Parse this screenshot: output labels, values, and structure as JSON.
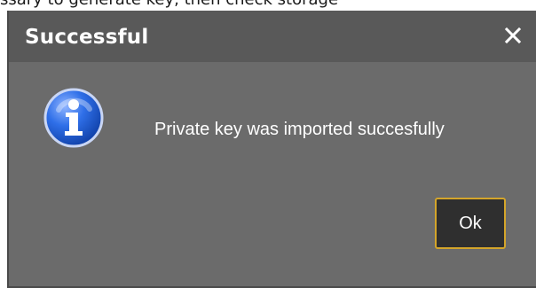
{
  "background": {
    "clipped_text": "ssary to generate key, then check storage"
  },
  "dialog": {
    "title": "Successful",
    "message": "Private key was imported succesfully",
    "close_icon": "close-icon",
    "status_icon": "info-icon",
    "ok_label": "Ok"
  },
  "colors": {
    "dialog_background": "#6b6b6b",
    "titlebar_background": "#595959",
    "text": "#ffffff",
    "ok_border": "#d4a52a",
    "ok_background": "#2f2f2f",
    "info_blue": "#1f5bd1"
  }
}
